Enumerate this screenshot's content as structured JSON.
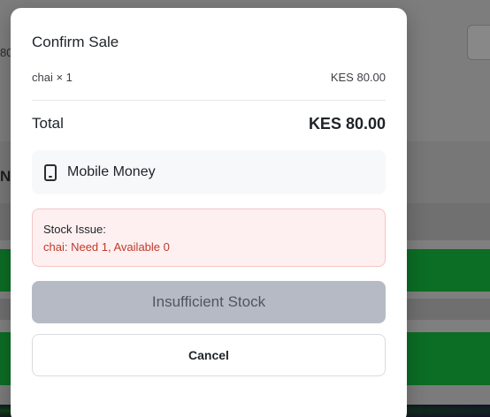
{
  "background": {
    "fragment_left": "80",
    "fragment_heading": "N"
  },
  "modal": {
    "title": "Confirm Sale",
    "line_item": {
      "name": "chai × 1",
      "amount": "KES 80.00"
    },
    "total": {
      "label": "Total",
      "amount": "KES 80.00"
    },
    "payment_method": {
      "icon": "phone-icon",
      "label": "Mobile Money"
    },
    "alert": {
      "heading": "Stock Issue:",
      "message": "chai: Need 1, Available 0"
    },
    "primary_button": {
      "label": "Insufficient Stock",
      "disabled": true
    },
    "cancel_button": {
      "label": "Cancel"
    }
  },
  "colors": {
    "alert_text": "#c0392b",
    "alert_bg": "#fef0f0",
    "disabled_button": "#b6bac4",
    "background_green": "#0c6d24"
  }
}
